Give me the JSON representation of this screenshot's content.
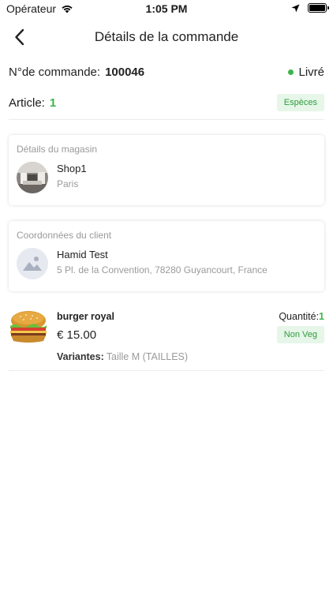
{
  "status_bar": {
    "carrier": "Opérateur",
    "time": "1:05 PM",
    "wifi_icon": "wifi-icon",
    "location_icon": "location-arrow-icon",
    "battery_icon": "battery-icon"
  },
  "header": {
    "title": "Détails de la commande",
    "back_icon": "chevron-left-icon"
  },
  "order": {
    "number_label": "N°de commande:",
    "number": "100046",
    "status": "Livré",
    "status_color": "#3cb44b",
    "article_label": "Article:",
    "article_count": "1",
    "payment_badge": "Espèces"
  },
  "store_card": {
    "title": "Détails du magasin",
    "name": "Shop1",
    "city": "Paris",
    "avatar_icon": "store-photo"
  },
  "customer_card": {
    "title": "Coordonnées du client",
    "name": "Hamid Test",
    "address": "5 Pl. de la Convention, 78280 Guyancourt, France",
    "avatar_icon": "image-placeholder-icon"
  },
  "product": {
    "name": "burger royal",
    "price": "€ 15.00",
    "quantity_label": "Quantité:",
    "quantity": "1",
    "badge": "Non Veg",
    "variants_label": "Variantes:",
    "variants_value": "Taille M (TAILLES)",
    "image_icon": "burger-image"
  },
  "colors": {
    "accent_green": "#3cb44b",
    "badge_bg": "#e6f6e8",
    "muted_text": "#9a9a9a"
  }
}
